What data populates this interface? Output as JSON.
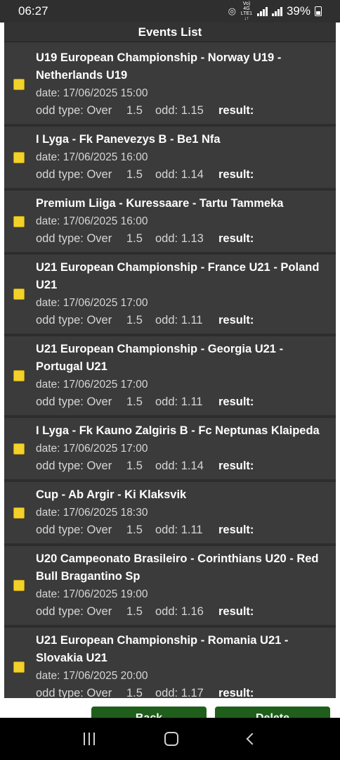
{
  "status_bar": {
    "time": "06:27",
    "network_label": "Vo) 4G\nLTE1 ↓↑",
    "battery": "39%"
  },
  "header": {
    "title": "Events List"
  },
  "events": [
    {
      "title": "U19 European Championship - Norway U19 - Netherlands U19",
      "date": "date: 17/06/2025 15:00",
      "odd_type": "odd type: Over",
      "odd_value": "1.5",
      "odd": "odd: 1.15",
      "result": "result:"
    },
    {
      "title": "I Lyga - Fk Panevezys B - Be1 Nfa",
      "date": "date: 17/06/2025 16:00",
      "odd_type": "odd type: Over",
      "odd_value": "1.5",
      "odd": "odd: 1.14",
      "result": "result:"
    },
    {
      "title": "Premium Liiga - Kuressaare - Tartu Tammeka",
      "date": "date: 17/06/2025 16:00",
      "odd_type": "odd type: Over",
      "odd_value": "1.5",
      "odd": "odd: 1.13",
      "result": "result:"
    },
    {
      "title": "U21 European Championship - France U21 - Poland U21",
      "date": "date: 17/06/2025 17:00",
      "odd_type": "odd type: Over",
      "odd_value": "1.5",
      "odd": "odd: 1.11",
      "result": "result:"
    },
    {
      "title": "U21 European Championship - Georgia U21 - Portugal U21",
      "date": "date: 17/06/2025 17:00",
      "odd_type": "odd type: Over",
      "odd_value": "1.5",
      "odd": "odd: 1.11",
      "result": "result:"
    },
    {
      "title": "I Lyga - Fk Kauno Zalgiris B - Fc Neptunas Klaipeda",
      "date": "date: 17/06/2025 17:00",
      "odd_type": "odd type: Over",
      "odd_value": "1.5",
      "odd": "odd: 1.14",
      "result": "result:"
    },
    {
      "title": "Cup - Ab Argir - Ki Klaksvik",
      "date": "date: 17/06/2025 18:30",
      "odd_type": "odd type: Over",
      "odd_value": "1.5",
      "odd": "odd: 1.11",
      "result": "result:"
    },
    {
      "title": "U20 Campeonato Brasileiro - Corinthians U20 - Red Bull Bragantino Sp",
      "date": "date: 17/06/2025 19:00",
      "odd_type": "odd type: Over",
      "odd_value": "1.5",
      "odd": "odd: 1.16",
      "result": "result:"
    },
    {
      "title": "U21 European Championship - Romania U21 - Slovakia U21",
      "date": "date: 17/06/2025 20:00",
      "odd_type": "odd type: Over",
      "odd_value": "1.5",
      "odd": "odd: 1.17",
      "result": "result:"
    }
  ],
  "buttons": {
    "back_label": "Back",
    "delete_label": "Delete"
  },
  "colors": {
    "marker": "#f2d22a",
    "button": "#1f5e1b",
    "row_bg": "#3b3b3b"
  },
  "icons": [
    "hotspot-icon",
    "signal-icon",
    "battery-icon",
    "recents-icon",
    "home-icon",
    "back-icon"
  ]
}
